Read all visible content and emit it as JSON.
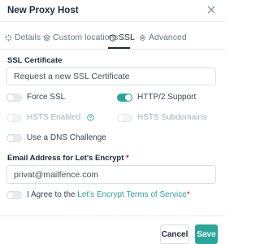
{
  "header": {
    "title": "New Proxy Host"
  },
  "tabs": [
    {
      "label": "Details",
      "icon": "bolt-icon"
    },
    {
      "label": "Custom locations",
      "icon": "layers-icon"
    },
    {
      "label": "SSL",
      "icon": "shield-icon",
      "active": true
    },
    {
      "label": "Advanced",
      "icon": "gear-icon"
    }
  ],
  "ssl": {
    "certificate_label": "SSL Certificate",
    "certificate_value": "Request a new SSL Certificate",
    "force_ssl": {
      "label": "Force SSL",
      "on": false
    },
    "http2": {
      "label": "HTTP/2 Support",
      "on": true
    },
    "hsts_enabled": {
      "label": "HSTS Enabled",
      "on": false,
      "disabled": true
    },
    "hsts_subdomains": {
      "label": "HSTS Subdomains",
      "on": false,
      "disabled": true
    },
    "dns_challenge": {
      "label": "Use a DNS Challenge",
      "on": false
    },
    "email_label": "Email Address for Let's Encrypt",
    "email_required_mark": "*",
    "email_value": "privat@mailfence.com",
    "agree_prefix": "I Agree to the ",
    "agree_link": "Let's Encrypt Terms of Service",
    "agree_required_mark": "*"
  },
  "footer": {
    "cancel_label": "Cancel",
    "save_label": "Save"
  },
  "colors": {
    "accent": "#2aa79b",
    "required": "#cd201f"
  }
}
